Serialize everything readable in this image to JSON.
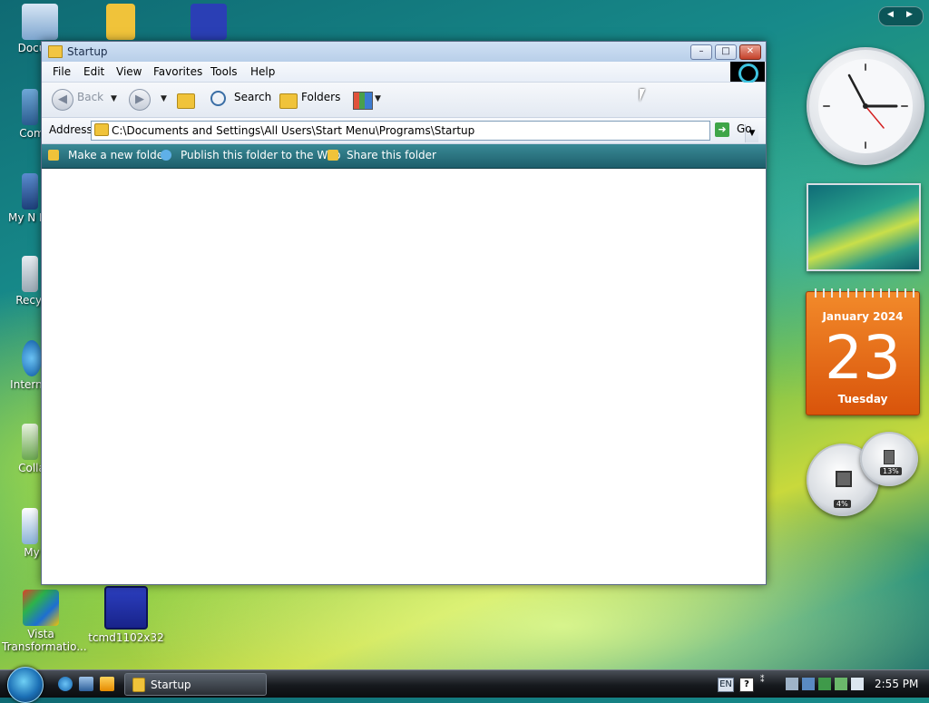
{
  "desktop": {
    "icons": [
      {
        "label": "Docu"
      },
      {
        "label": ""
      },
      {
        "label": ""
      },
      {
        "label": "Com"
      },
      {
        "label": "My N Pla"
      },
      {
        "label": "Recyc"
      },
      {
        "label": "Internet"
      },
      {
        "label": "Colla"
      },
      {
        "label": "My"
      },
      {
        "label": "Vista Transformatio..."
      },
      {
        "label": "tcmd1102x32"
      }
    ]
  },
  "window": {
    "title": "Startup",
    "menu": [
      "File",
      "Edit",
      "View",
      "Favorites",
      "Tools",
      "Help"
    ],
    "toolbar": {
      "back_label": "Back",
      "search_label": "Search",
      "folders_label": "Folders"
    },
    "address": {
      "label": "Address",
      "value": "C:\\Documents and Settings\\All Users\\Start Menu\\Programs\\Startup",
      "go_label": "Go"
    },
    "tasks": [
      "Make a new folder",
      "Publish this folder to the Web",
      "Share this folder"
    ]
  },
  "gadgets": {
    "calendar": {
      "month": "January 2024",
      "day": "23",
      "weekday": "Tuesday"
    },
    "cpu_meter": {
      "cpu": "4%",
      "memory": "13%"
    }
  },
  "taskbar": {
    "task_label": "Startup",
    "language": "EN",
    "time": "2:55 PM"
  },
  "colors": {
    "calendar_orange": "#e8661a",
    "tasks_teal": "#2b7480",
    "taskbar_dark": "#16191d"
  }
}
